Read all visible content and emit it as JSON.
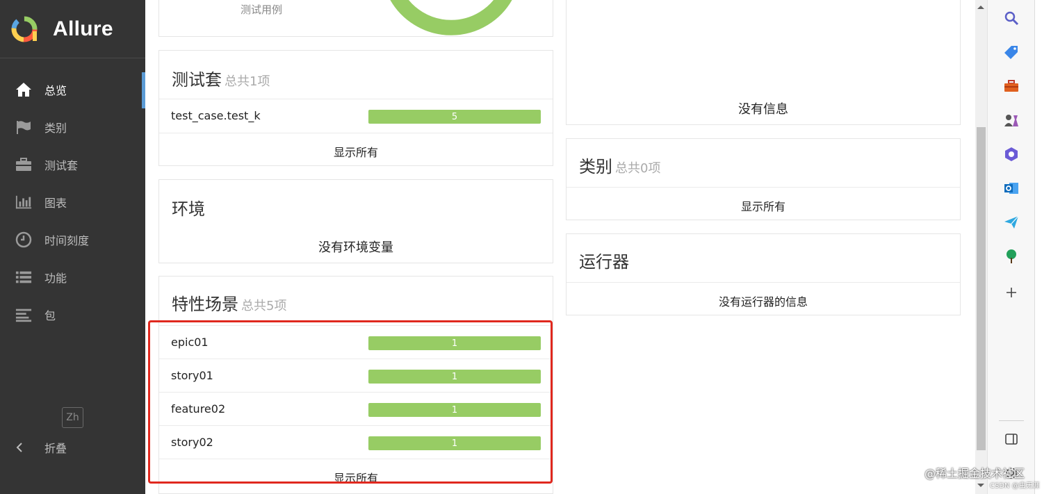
{
  "app": {
    "name": "Allure"
  },
  "sidebar": {
    "items": [
      {
        "label": "总览",
        "icon": "home-icon",
        "active": true
      },
      {
        "label": "类别",
        "icon": "flag-icon",
        "active": false
      },
      {
        "label": "测试套",
        "icon": "briefcase-icon",
        "active": false
      },
      {
        "label": "图表",
        "icon": "bar-chart-icon",
        "active": false
      },
      {
        "label": "时间刻度",
        "icon": "clock-icon",
        "active": false
      },
      {
        "label": "功能",
        "icon": "list-icon",
        "active": false
      },
      {
        "label": "包",
        "icon": "align-left-icon",
        "active": false
      }
    ],
    "language": "Zh",
    "collapse_label": "折叠"
  },
  "top_card": {
    "caption": "测试用例"
  },
  "suites": {
    "title": "测试套",
    "count": "总共1项",
    "rows": [
      {
        "name": "test_case.test_k",
        "value": "5"
      }
    ],
    "show_all": "显示所有"
  },
  "environment": {
    "title": "环境",
    "empty": "没有环境变量"
  },
  "features": {
    "title": "特性场景",
    "count": "总共5项",
    "rows": [
      {
        "name": "epic01",
        "value": "1"
      },
      {
        "name": "story01",
        "value": "1"
      },
      {
        "name": "feature02",
        "value": "1"
      },
      {
        "name": "story02",
        "value": "1"
      }
    ],
    "show_all": "显示所有"
  },
  "right_top": {
    "empty": "没有信息"
  },
  "categories": {
    "title": "类别",
    "count": "总共0项",
    "show_all": "显示所有"
  },
  "executors": {
    "title": "运行器",
    "empty": "没有运行器的信息"
  },
  "colors": {
    "passed_bar": "#97cc64",
    "sidebar_bg": "#343434",
    "highlight_border": "#e0281e",
    "active_indicator": "#5b9bd5"
  },
  "edge_sidebar": {
    "buttons": [
      "search-icon",
      "tag-icon",
      "toolbox-icon",
      "games-icon",
      "copilot-icon",
      "outlook-icon",
      "send-icon",
      "tree-icon",
      "plus-icon",
      "split-screen-icon",
      "settings-icon"
    ]
  },
  "watermark": {
    "line1": "@稀土掘金技术社区",
    "line2": "CSDN @虫无涯"
  }
}
